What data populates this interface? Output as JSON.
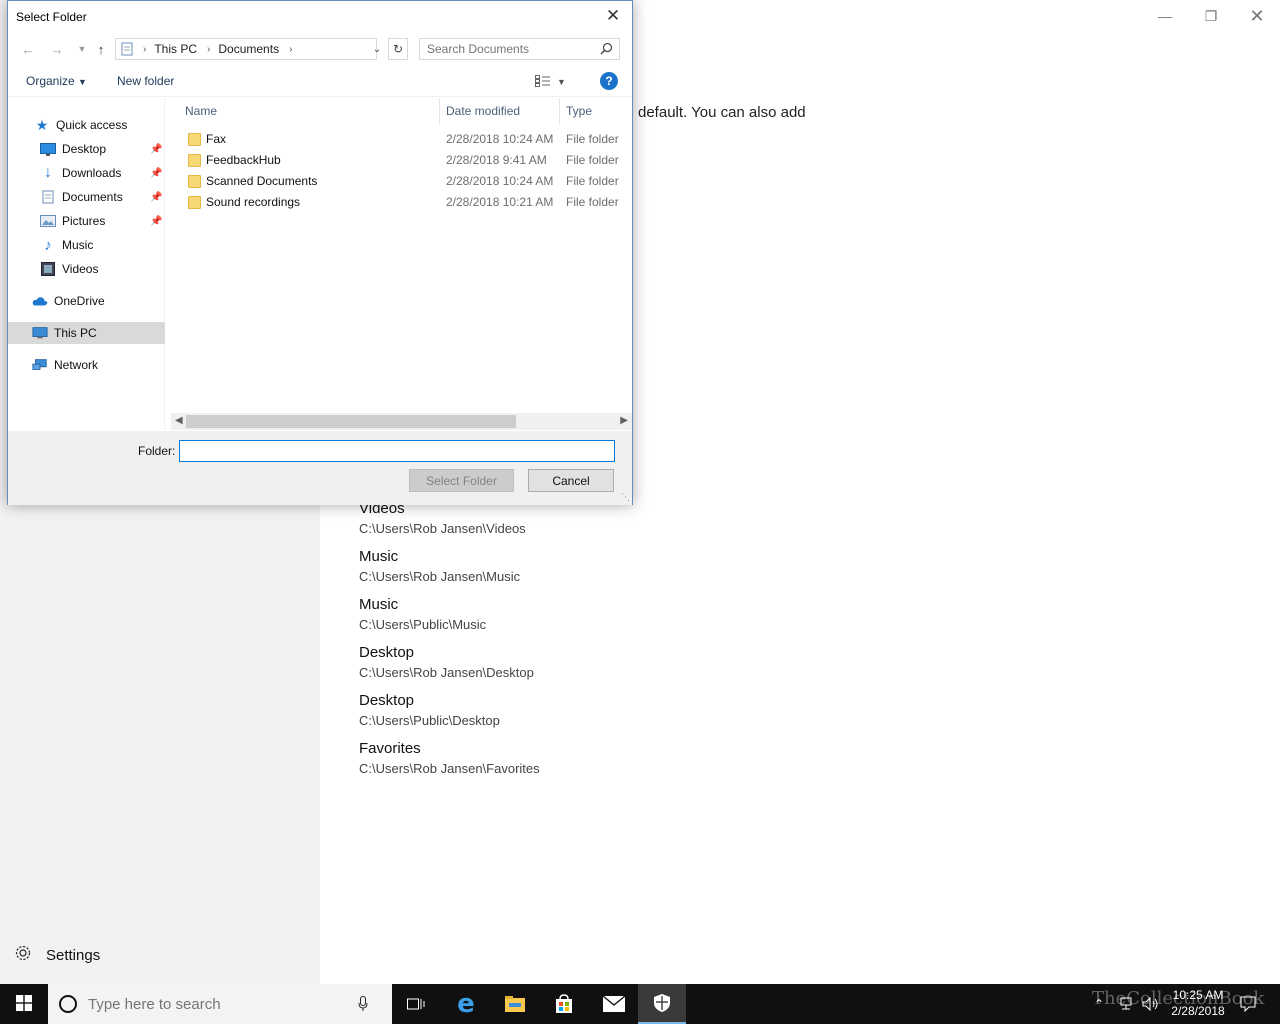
{
  "background": {
    "intro_text": "default. You can also add",
    "libraries": [
      {
        "name": "Videos",
        "path": "C:\\Users\\Rob Jansen\\Videos"
      },
      {
        "name": "Music",
        "path": "C:\\Users\\Rob Jansen\\Music"
      },
      {
        "name": "Music",
        "path": "C:\\Users\\Public\\Music"
      },
      {
        "name": "Desktop",
        "path": "C:\\Users\\Rob Jansen\\Desktop"
      },
      {
        "name": "Desktop",
        "path": "C:\\Users\\Public\\Desktop"
      },
      {
        "name": "Favorites",
        "path": "C:\\Users\\Rob Jansen\\Favorites"
      }
    ],
    "settings_label": "Settings"
  },
  "dialog": {
    "title": "Select Folder",
    "address": {
      "segments": [
        "This PC",
        "Documents"
      ]
    },
    "search_placeholder": "Search Documents",
    "toolbar": {
      "organize": "Organize",
      "new_folder": "New folder",
      "help": "?"
    },
    "nav": {
      "quick_access": "Quick access",
      "desktop": "Desktop",
      "downloads": "Downloads",
      "documents": "Documents",
      "pictures": "Pictures",
      "music": "Music",
      "videos": "Videos",
      "onedrive": "OneDrive",
      "this_pc": "This PC",
      "network": "Network"
    },
    "columns": {
      "name": "Name",
      "date": "Date modified",
      "type": "Type"
    },
    "files": [
      {
        "name": "Fax",
        "date": "2/28/2018 10:24 AM",
        "type": "File folder"
      },
      {
        "name": "FeedbackHub",
        "date": "2/28/2018 9:41 AM",
        "type": "File folder"
      },
      {
        "name": "Scanned Documents",
        "date": "2/28/2018 10:24 AM",
        "type": "File folder"
      },
      {
        "name": "Sound recordings",
        "date": "2/28/2018 10:21 AM",
        "type": "File folder"
      }
    ],
    "folder_label": "Folder:",
    "folder_value": "",
    "select_button": "Select Folder",
    "cancel_button": "Cancel"
  },
  "taskbar": {
    "search_placeholder": "Type here to search",
    "time": "10:25 AM",
    "date": "2/28/2018",
    "watermark": "TheCollectionBook"
  }
}
